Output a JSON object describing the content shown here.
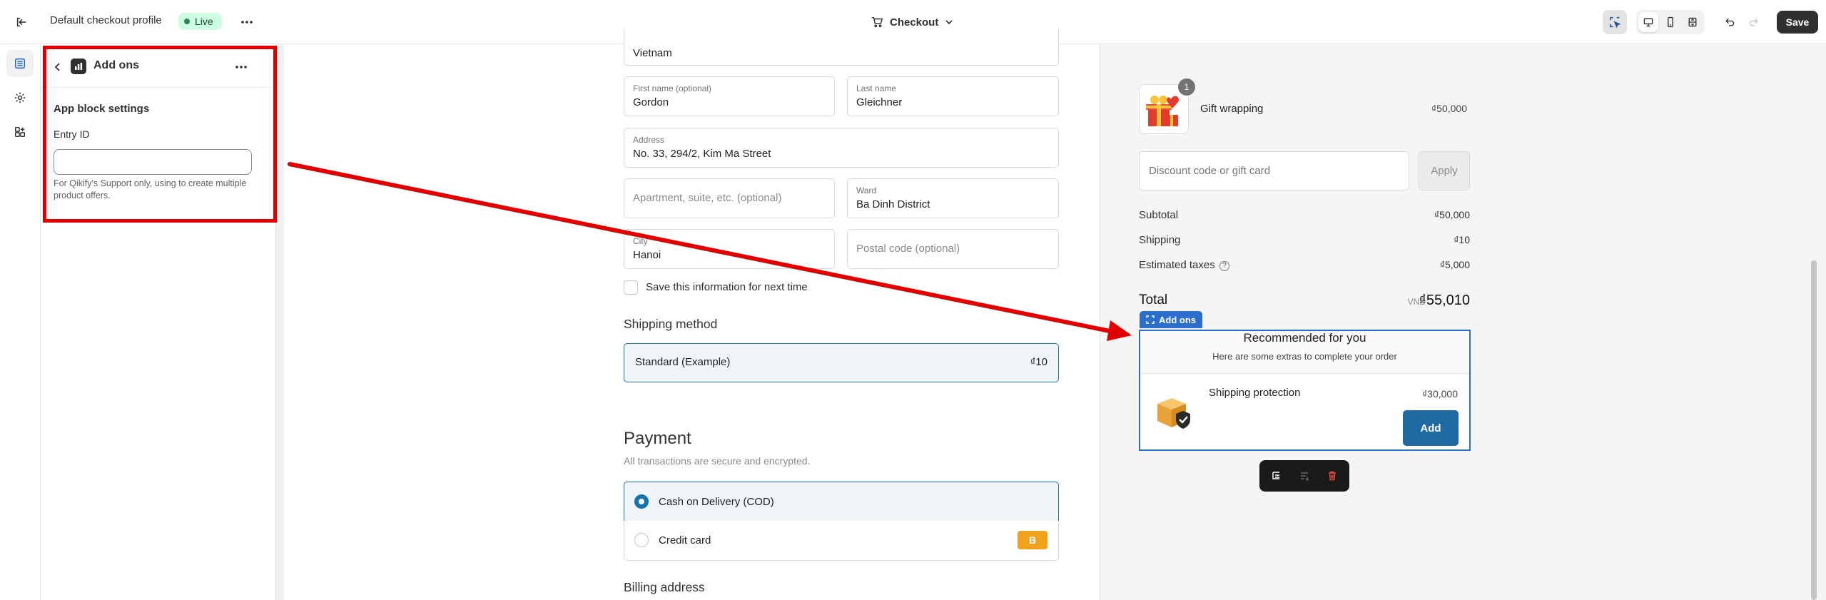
{
  "topbar": {
    "profile_title": "Default checkout profile",
    "status_badge": "Live",
    "page_selector": "Checkout",
    "save_label": "Save"
  },
  "panel": {
    "title": "Add ons",
    "section_title": "App block settings",
    "entry_label": "Entry ID",
    "entry_value": "",
    "help_text": "For Qikify's Support only, using to create multiple product offers."
  },
  "form": {
    "country_value": "Vietnam",
    "first_name": {
      "label": "First name (optional)",
      "value": "Gordon"
    },
    "last_name": {
      "label": "Last name",
      "value": "Gleichner"
    },
    "address": {
      "label": "Address",
      "value": "No. 33, 294/2, Kim Ma Street"
    },
    "apartment": {
      "placeholder": "Apartment, suite, etc. (optional)"
    },
    "ward": {
      "label": "Ward",
      "value": "Ba Dinh District"
    },
    "city": {
      "label": "City",
      "value": "Hanoi"
    },
    "postal": {
      "placeholder": "Postal code (optional)"
    },
    "save_info_label": "Save this information for next time",
    "shipping_heading": "Shipping method",
    "shipping_option": {
      "name": "Standard (Example)",
      "price": "₫10"
    },
    "payment_heading": "Payment",
    "payment_subtitle": "All transactions are secure and encrypted.",
    "payment_options": [
      {
        "name": "Cash on Delivery (COD)",
        "selected": true
      },
      {
        "name": "Credit card",
        "selected": false,
        "badge": "B"
      }
    ],
    "billing_heading": "Billing address"
  },
  "summary": {
    "item": {
      "name": "Gift wrapping",
      "price": "₫50,000",
      "quantity": "1"
    },
    "discount_placeholder": "Discount code or gift card",
    "apply_label": "Apply",
    "subtotal_label": "Subtotal",
    "subtotal_value": "₫50,000",
    "shipping_label": "Shipping",
    "shipping_value": "₫10",
    "taxes_label": "Estimated taxes",
    "taxes_value": "₫5,000",
    "total_label": "Total",
    "total_currency": "VND",
    "total_value": "₫55,010"
  },
  "addon_block": {
    "tag_label": "Add ons",
    "title": "Recommended for you",
    "subtitle": "Here are some extras to complete your order",
    "product_name": "Shipping protection",
    "product_price": "₫30,000",
    "add_label": "Add"
  },
  "colors": {
    "annotation_red": "#e00000",
    "selection_blue": "#2c6ecb",
    "accent_blue": "#1773b0",
    "add_button": "#1f6aa3",
    "live_badge": "#cdfee1"
  }
}
